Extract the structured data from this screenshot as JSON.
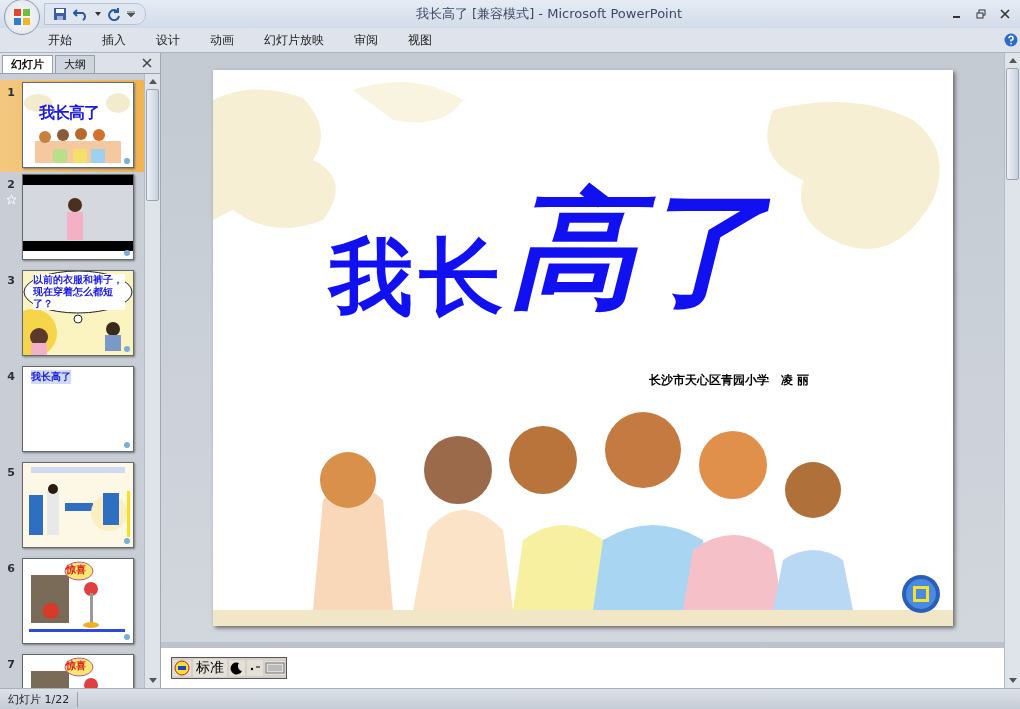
{
  "window": {
    "title": "我长高了 [兼容模式] - Microsoft PowerPoint"
  },
  "ribbon_tabs": [
    {
      "label": "开始"
    },
    {
      "label": "插入"
    },
    {
      "label": "设计"
    },
    {
      "label": "动画"
    },
    {
      "label": "幻灯片放映"
    },
    {
      "label": "审阅"
    },
    {
      "label": "视图"
    }
  ],
  "pane_tabs": [
    {
      "label": "幻灯片",
      "selected": true
    },
    {
      "label": "大纲",
      "selected": false
    }
  ],
  "thumbnails": [
    {
      "number": "1",
      "selected": true,
      "animated": false,
      "kind": "title",
      "text": "我长高了"
    },
    {
      "number": "2",
      "selected": false,
      "animated": true,
      "kind": "video"
    },
    {
      "number": "3",
      "selected": false,
      "animated": false,
      "kind": "bubble",
      "text": "以前的衣服和裤子，现在穿着怎么都短了？"
    },
    {
      "number": "4",
      "selected": false,
      "animated": false,
      "kind": "heading",
      "text": "我长高了"
    },
    {
      "number": "5",
      "selected": false,
      "animated": false
    },
    {
      "number": "6",
      "selected": false,
      "animated": false,
      "kind": "tag",
      "text": "惊喜"
    },
    {
      "number": "7",
      "selected": false,
      "animated": false,
      "kind": "tag",
      "text": "惊喜"
    }
  ],
  "slide": {
    "title_start": "我长",
    "title_end": "高了",
    "author": "长沙市天心区青园小学　凌 丽"
  },
  "ime_toolbar": {
    "mode": "标准"
  },
  "status_bar": {
    "slide_counter": "幻灯片 1/22"
  }
}
